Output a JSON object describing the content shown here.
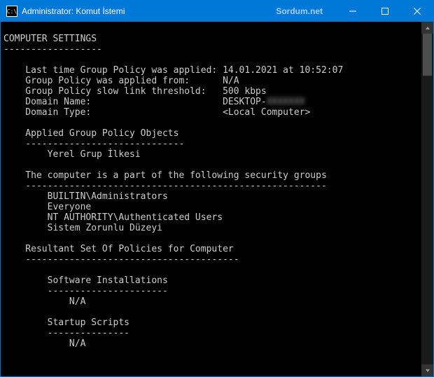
{
  "titlebar": {
    "icon_text": "C:\\",
    "title": "Administrator: Komut İstemi",
    "watermark": "Sordum.net"
  },
  "console": {
    "blank0": "",
    "header": "COMPUTER SETTINGS",
    "header_underline": "------------------",
    "blank1": "",
    "policy": {
      "last_applied_label": "    Last time Group Policy was applied: ",
      "last_applied_value": "14.01.2021 at 10:52:07",
      "applied_from_label": "    Group Policy was applied from:      ",
      "applied_from_value": "N/A",
      "slow_link_label": "    Group Policy slow link threshold:   ",
      "slow_link_value": "500 kbps",
      "domain_name_label": "    Domain Name:                        ",
      "domain_name_value": "DESKTOP-",
      "domain_name_blurred": "XXXXXXX",
      "domain_type_label": "    Domain Type:                        ",
      "domain_type_value": "<Local Computer>"
    },
    "blank2": "",
    "applied_gpo_title": "    Applied Group Policy Objects",
    "applied_gpo_ul": "    -----------------------------",
    "applied_gpo_item": "        Yerel Grup İlkesi",
    "blank3": "",
    "sec_groups_title": "    The computer is a part of the following security groups",
    "sec_groups_ul": "    -------------------------------------------------------",
    "sec_groups": {
      "g0": "        BUILTIN\\Administrators",
      "g1": "        Everyone",
      "g2": "        NT AUTHORITY\\Authenticated Users",
      "g3": "        Sistem Zorunlu Düzeyi"
    },
    "blank4": "",
    "rsop_title": "    Resultant Set Of Policies for Computer",
    "rsop_ul": "    ---------------------------------------",
    "blank5": "",
    "soft_inst_title": "        Software Installations",
    "soft_inst_ul": "        ----------------------",
    "soft_inst_val": "            N/A",
    "blank6": "",
    "startup_title": "        Startup Scripts",
    "startup_ul": "        ---------------",
    "startup_val": "            N/A"
  }
}
